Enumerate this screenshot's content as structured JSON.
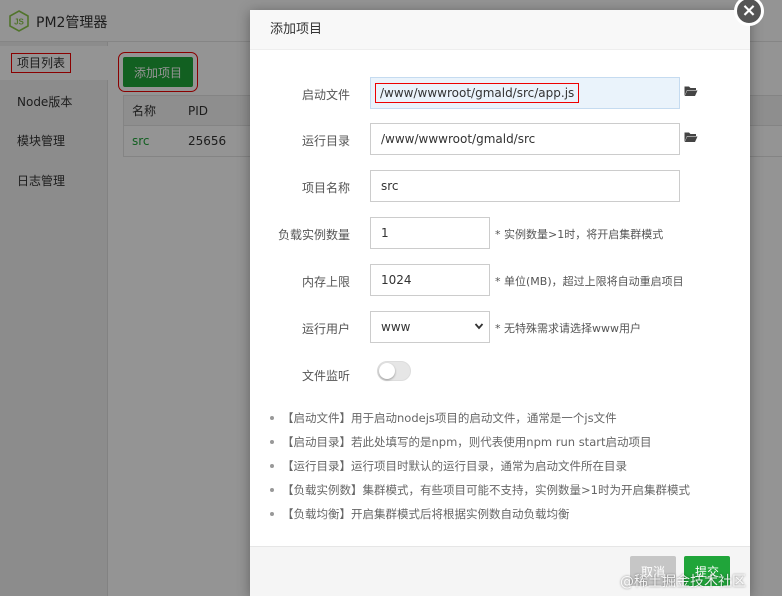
{
  "app": {
    "title": "PM2管理器",
    "sidebar": [
      {
        "label": "项目列表"
      },
      {
        "label": "Node版本"
      },
      {
        "label": "模块管理"
      },
      {
        "label": "日志管理"
      }
    ],
    "add_button": "添加项目",
    "table": {
      "headers": [
        "名称",
        "PID"
      ],
      "rows": [
        {
          "name": "src",
          "pid": "25656"
        }
      ]
    }
  },
  "dialog": {
    "title": "添加项目",
    "fields": {
      "start_file": {
        "label": "启动文件",
        "value": "/www/wwwroot/gmald/src/app.js"
      },
      "run_dir": {
        "label": "运行目录",
        "value": "/www/wwwroot/gmald/src"
      },
      "project_name": {
        "label": "项目名称",
        "value": "src"
      },
      "instances": {
        "label": "负载实例数量",
        "value": "1",
        "hint": "* 实例数量>1时，将开启集群模式"
      },
      "memory": {
        "label": "内存上限",
        "value": "1024",
        "hint": "* 单位(MB)，超过上限将自动重启项目"
      },
      "run_user": {
        "label": "运行用户",
        "value": "www",
        "hint": "* 无特殊需求请选择www用户"
      },
      "watch": {
        "label": "文件监听",
        "enabled": false
      }
    },
    "notes": [
      "【启动文件】用于启动nodejs项目的启动文件，通常是一个js文件",
      "【启动目录】若此处填写的是npm，则代表使用npm run start启动项目",
      "【运行目录】运行项目时默认的运行目录，通常为启动文件所在目录",
      "【负载实例数】集群模式，有些项目可能不支持，实例数量>1时为开启集群模式",
      "【负载均衡】开启集群模式后将根据实例数自动负载均衡"
    ],
    "cancel": "取消",
    "submit": "提交"
  },
  "watermark": "@稀土掘金技术社区",
  "colors": {
    "accent": "#20a53a",
    "highlight": "#ee0000"
  }
}
